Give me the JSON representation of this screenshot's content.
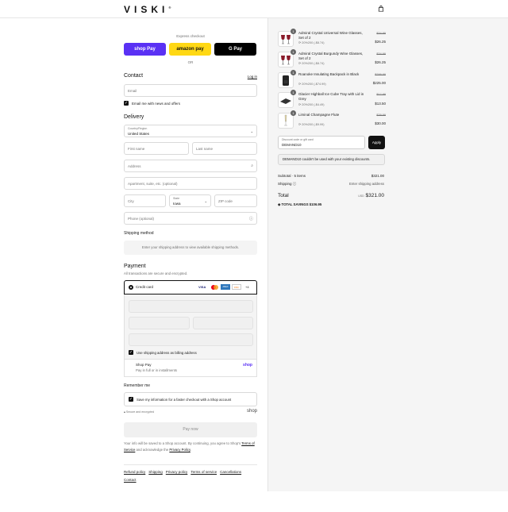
{
  "header": {
    "logo": "VISKI",
    "trademark": "®"
  },
  "express": {
    "title": "Express checkout",
    "or": "OR",
    "shop_pay": "shop Pay",
    "amazon_pay": "amazon pay",
    "google_pay": "G Pay"
  },
  "contact": {
    "title": "Contact",
    "login": "Log in",
    "email_placeholder": "Email",
    "news_label": "Email me with news and offers"
  },
  "delivery": {
    "title": "Delivery",
    "country_label": "Country/Region",
    "country_value": "United States",
    "first_name": "First name",
    "last_name": "Last name",
    "address": "Address",
    "apartment": "Apartment, suite, etc. (optional)",
    "city": "City",
    "state_label": "State",
    "state_value": "Iowa",
    "zip": "ZIP code",
    "phone": "Phone (optional)"
  },
  "shipping": {
    "title": "Shipping method",
    "message": "Enter your shipping address to view available shipping methods."
  },
  "payment": {
    "title": "Payment",
    "subtitle": "All transactions are secure and encrypted.",
    "credit_card": "Credit card",
    "more_cards": "+4",
    "billing_label": "Use shipping address as billing address",
    "shop_pay_title": "Shop Pay",
    "shop_pay_sub": "Pay in full or in installments",
    "shop_logo": "shop"
  },
  "remember": {
    "title": "Remember me",
    "save_label": "Save my information for a faster checkout with a Shop account",
    "secure": "Secure and encrypted",
    "shop_logo": "shop"
  },
  "pay_now": "Pay now",
  "legal": {
    "text1": "Your info will be saved to a Shop account. By continuing, you agree to Shop's",
    "terms": "Terms of Service",
    "text2": "and acknowledge the",
    "privacy": "Privacy Policy",
    "end": "."
  },
  "footer": {
    "links": [
      "Refund policy",
      "Shipping",
      "Privacy policy",
      "Terms of service",
      "Cancellations"
    ],
    "contact": "Contact"
  },
  "cart": {
    "items": [
      {
        "qty": "1",
        "name": "Admiral Crystal Universal Wine Glasses, Set of 2",
        "discount": "20%200 (-$8.74)",
        "old": "$34.99",
        "price": "$26.25"
      },
      {
        "qty": "1",
        "name": "Admiral Crystal Burgundy Wine Glasses, Set of 2",
        "discount": "20%200 (-$8.74)",
        "old": "$34.99",
        "price": "$26.25"
      },
      {
        "qty": "1",
        "name": "Roanoke Insulating Backpack in Black",
        "discount": "20%200 (-$74.99)",
        "old": "$299.99",
        "price": "$225.00"
      },
      {
        "qty": "1",
        "name": "Glacier Highball Ice Cube Tray with Lid in Grey",
        "discount": "20%200 (-$4.49)",
        "old": "$17.99",
        "price": "$13.50"
      },
      {
        "qty": "1",
        "name": "Liminal Champagne Flute",
        "discount": "20%200 (-$9.99)",
        "old": "$39.99",
        "price": "$30.00"
      }
    ],
    "discount_label": "Discount code or gift card",
    "discount_value": "DEMAND10",
    "apply": "Apply",
    "discount_error": "DEMAND10 couldn't be used with your existing discounts.",
    "subtotal_label": "Subtotal · 5 items",
    "subtotal": "$321.00",
    "shipping_label": "Shipping",
    "shipping_value": "Enter shipping address",
    "total_label": "Total",
    "currency": "USD",
    "total": "$321.00",
    "savings_label": "TOTAL SAVINGS",
    "savings": "$106.95"
  },
  "colors": {
    "shop_pay": "#5a31f4",
    "amazon": "#ffd814",
    "dark": "#111111"
  }
}
